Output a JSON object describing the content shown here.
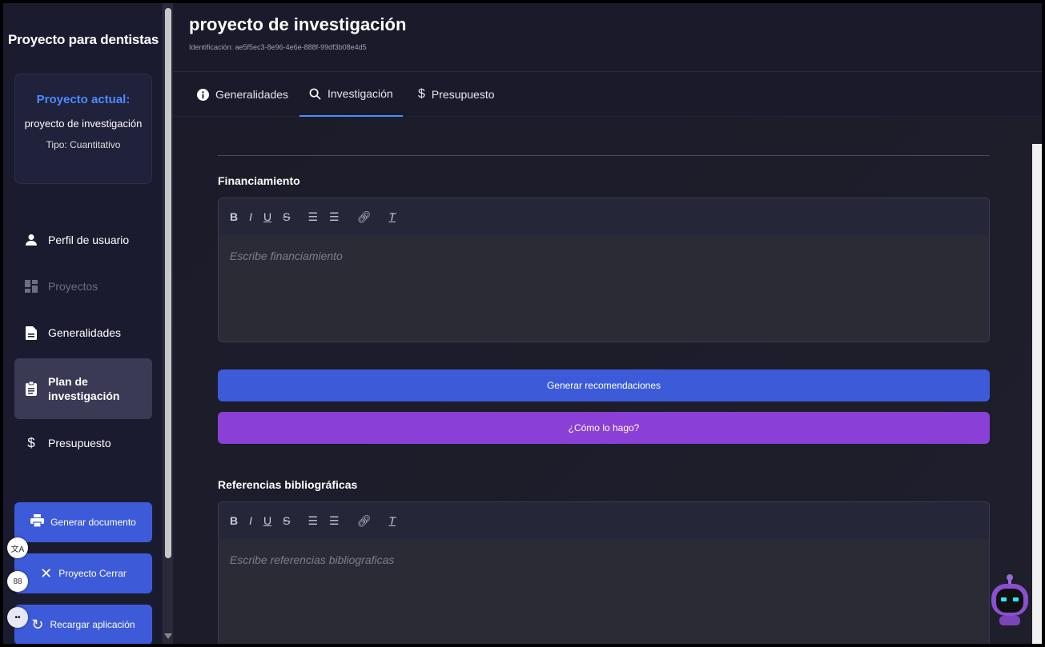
{
  "sidebar": {
    "app_title": "Proyecto para dentistas",
    "project_card": {
      "label": "Proyecto actual:",
      "name": "proyecto de investigación",
      "type": "Tipo: Cuantitativo"
    },
    "items": [
      {
        "label": "Perfil de usuario",
        "icon": "user-icon"
      },
      {
        "label": "Proyectos",
        "icon": "grid-icon"
      },
      {
        "label": "Generalidades",
        "icon": "document-icon"
      },
      {
        "label": "Plan de investigación",
        "icon": "clipboard-icon"
      },
      {
        "label": "Presupuesto",
        "icon": "dollar-icon"
      }
    ],
    "buttons": {
      "generate_doc": "Generar documento",
      "close_project": "Proyecto Cerrar",
      "reload": "Recargar aplicación"
    }
  },
  "header": {
    "title": "proyecto de investigación",
    "id_line": "Identificación: ae5f5ec3-8e96-4e6e-888f-99df3b08e4d5"
  },
  "tabs": [
    {
      "label": "Generalidades",
      "icon": "info-icon"
    },
    {
      "label": "Investigación",
      "icon": "search-icon"
    },
    {
      "label": "Presupuesto",
      "icon": "dollar-icon"
    }
  ],
  "main": {
    "funding": {
      "label": "Financiamiento",
      "placeholder": "Escribe financiamiento"
    },
    "generate_button": "Generar recomendaciones",
    "howto_button": "¿Cómo lo hago?",
    "references": {
      "label": "Referencias bibliográficas",
      "placeholder": "Escribe referencias bibliograficas"
    }
  },
  "colors": {
    "accent_blue": "#3d5bd9",
    "accent_purple": "#8a3fd6",
    "tab_underline": "#4f8ef7"
  }
}
